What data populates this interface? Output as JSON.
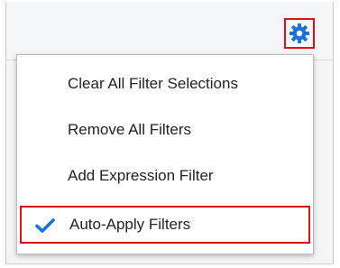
{
  "toolbar": {
    "settings_icon": "gear-icon",
    "accent_color": "#1a73d9",
    "highlight_color": "#e0101a"
  },
  "menu": {
    "items": [
      {
        "label": "Clear All Filter Selections",
        "checked": false
      },
      {
        "label": "Remove All Filters",
        "checked": false
      },
      {
        "label": "Add Expression Filter",
        "checked": false
      },
      {
        "label": "Auto-Apply Filters",
        "checked": true,
        "check_icon": "checkmark-icon"
      }
    ]
  }
}
